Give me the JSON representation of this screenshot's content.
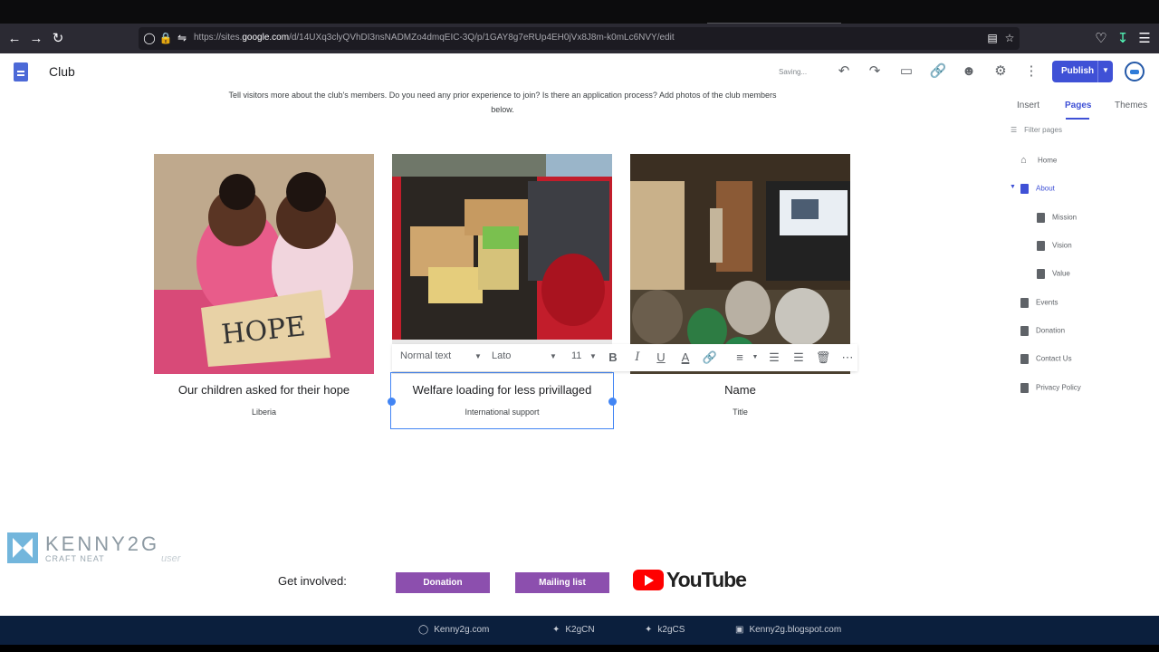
{
  "browser": {
    "url_prefix": "https://sites.",
    "url_domain": "google.com",
    "url_path": "/d/14UXq3clyQVhDI3nsNADMZo4dmqEIC-3Q/p/1GAY8g7eRUp4EH0jVx8J8m-k0mLc6NVY/edit"
  },
  "app": {
    "title": "Club",
    "status": "Saving...",
    "publish_label": "Publish"
  },
  "content": {
    "intro": "Tell visitors more about the club's members. Do you need any prior experience to join? Is there an application process? Add photos of the club members below.",
    "cards": [
      {
        "title": "Our children asked for their hope",
        "subtitle": "Liberia",
        "photo_text": "HOPE"
      },
      {
        "title": "Welfare loading for less privillaged",
        "subtitle": "International support"
      },
      {
        "title": "Name",
        "subtitle": "Title"
      }
    ],
    "format_toolbar": {
      "style": "Normal text",
      "font": "Lato",
      "size": "11"
    },
    "watermark": {
      "name": "KENNY2G",
      "tagline": "CRAFT NEAT",
      "suffix": "user"
    },
    "get_involved": "Get involved:",
    "buttons": [
      "Donation",
      "Mailing list"
    ],
    "youtube": "YouTube"
  },
  "panel": {
    "tabs": [
      "Insert",
      "Pages",
      "Themes"
    ],
    "filter_placeholder": "Filter pages",
    "pages": [
      "Home",
      "About",
      "Mission",
      "Vision",
      "Value",
      "Events",
      "Donation",
      "Contact Us",
      "Privacy Policy"
    ]
  },
  "overlay_bar": [
    "Kenny2g.com",
    "K2gCN",
    "k2gCS",
    "Kenny2g.blogspot.com"
  ],
  "colors": {
    "accent": "#3f51d6",
    "button_purple": "#8c4fae",
    "selection": "#4285f4"
  }
}
